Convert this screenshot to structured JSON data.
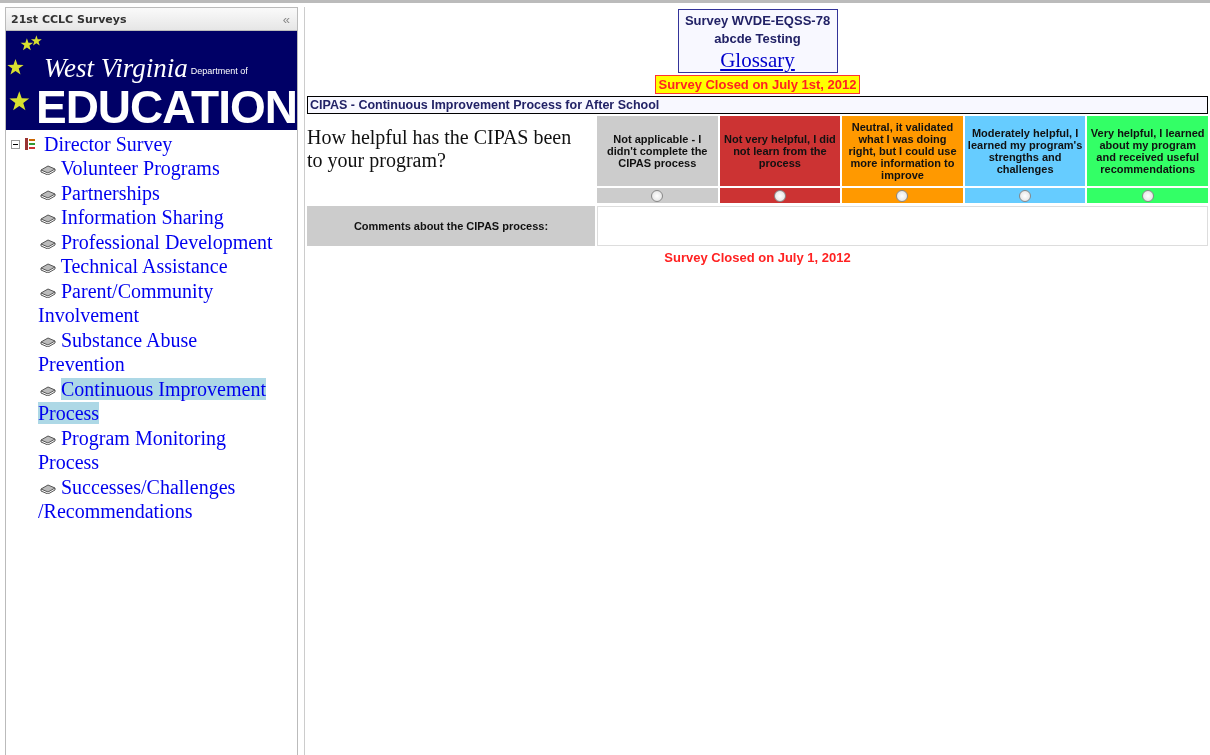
{
  "sidebar": {
    "title": "21st CCLC Surveys",
    "collapse": "«",
    "logo": {
      "script": "West Virginia",
      "dept": "Department of",
      "word": "EDUCATION"
    },
    "tree": {
      "label": "Director Survey",
      "expanded": true,
      "children": [
        {
          "label": "Volunteer Programs",
          "selected": false
        },
        {
          "label": "Partnerships",
          "selected": false
        },
        {
          "label": "Information Sharing",
          "selected": false
        },
        {
          "label": "Professional Development",
          "selected": false
        },
        {
          "label": "Technical Assistance",
          "selected": false
        },
        {
          "label": "Parent/Community Involvement",
          "selected": false
        },
        {
          "label": "Substance Abuse Prevention",
          "selected": false
        },
        {
          "label": "Continuous Improvement Process",
          "selected": true
        },
        {
          "label": "Program Monitoring Process",
          "selected": false
        },
        {
          "label": "Successes/Challenges /Recommendations",
          "selected": false
        }
      ]
    }
  },
  "header": {
    "survey": "Survey WVDE-EQSS-78",
    "name": "abcde Testing",
    "glossary": "Glossary"
  },
  "closed_notice": "Survey Closed on July 1st, 2012",
  "section": "CIPAS - Continuous Improvement Process for After School",
  "question": {
    "text": "How helpful has the CIPAS been to your program?",
    "options": [
      {
        "label": "Not applicable - I didn't complete the CIPAS process",
        "color": "#cccccc",
        "selected": false
      },
      {
        "label": "Not very helpful, I did not learn from the process",
        "color": "#cc3333",
        "selected": false
      },
      {
        "label": "Neutral, it validated what I was doing right, but I could use more information to improve",
        "color": "#ff9900",
        "selected": false
      },
      {
        "label": "Moderately helpful, I learned my program's strengths and challenges",
        "color": "#66ccff",
        "selected": false
      },
      {
        "label": "Very helpful, I learned about my program and received useful recommendations",
        "color": "#33ff66",
        "selected": false
      }
    ]
  },
  "comments_label": "Comments about the CIPAS process:",
  "footer_notice": "Survey Closed on July 1, 2012"
}
